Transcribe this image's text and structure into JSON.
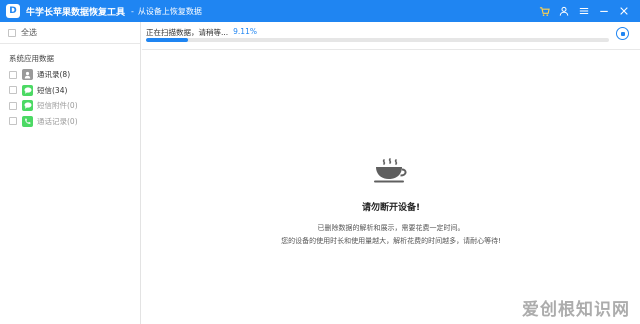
{
  "titlebar": {
    "app_title": "牛学长苹果数据恢复工具",
    "separator": "-",
    "subtitle": "从设备上恢复数据",
    "logo_letter": "D",
    "icons": [
      "cart-icon",
      "user-icon",
      "menu-icon",
      "minimize-icon",
      "close-icon"
    ],
    "accent": "#1f85f2"
  },
  "sidebar": {
    "select_all": "全选",
    "section_title": "系统应用数据",
    "items": [
      {
        "label": "通讯录(8)",
        "icon": "contacts-icon",
        "dim": false
      },
      {
        "label": "短信(34)",
        "icon": "sms-icon",
        "dim": false
      },
      {
        "label": "短信附件(0)",
        "icon": "attachment-icon",
        "dim": true
      },
      {
        "label": "通话记录(0)",
        "icon": "phone-icon",
        "dim": true
      }
    ]
  },
  "main": {
    "status_text": "正在扫描数据，请稍等...",
    "progress_percent_text": "9.11%",
    "progress_value": 0.0911,
    "center_title": "请勿断开设备!",
    "center_line1": "已删除数据的解析和展示，需要花费一定时间。",
    "center_line2": "您的设备的使用时长和使用量越大，解析花费的时间越多，请耐心等待!"
  },
  "watermark": "爱创根知识网"
}
